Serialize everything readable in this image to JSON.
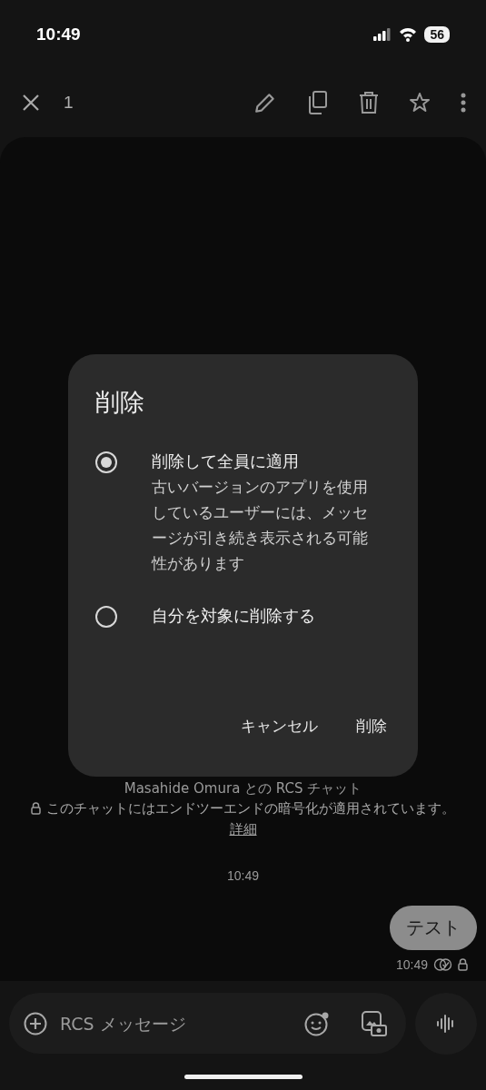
{
  "status_bar": {
    "time": "10:49",
    "battery": "56"
  },
  "toolbar": {
    "count": "1"
  },
  "chat": {
    "header": "Masahide Omura との RCS チャット",
    "encryption_notice": "このチャットにはエンドツーエンドの暗号化が適用されています。",
    "details_link": "詳細",
    "timestamp": "10:49",
    "messages": [
      {
        "text": "テスト",
        "time": "10:49"
      }
    ]
  },
  "composer": {
    "placeholder": "RCS メッセージ"
  },
  "dialog": {
    "title": "削除",
    "options": [
      {
        "label": "削除して全員に適用",
        "description": "古いバージョンのアプリを使用しているユーザーには、メッセージが引き続き表示される可能性があります",
        "selected": true
      },
      {
        "label": "自分を対象に削除する",
        "selected": false
      }
    ],
    "buttons": [
      "キャンセル",
      "削除"
    ]
  }
}
